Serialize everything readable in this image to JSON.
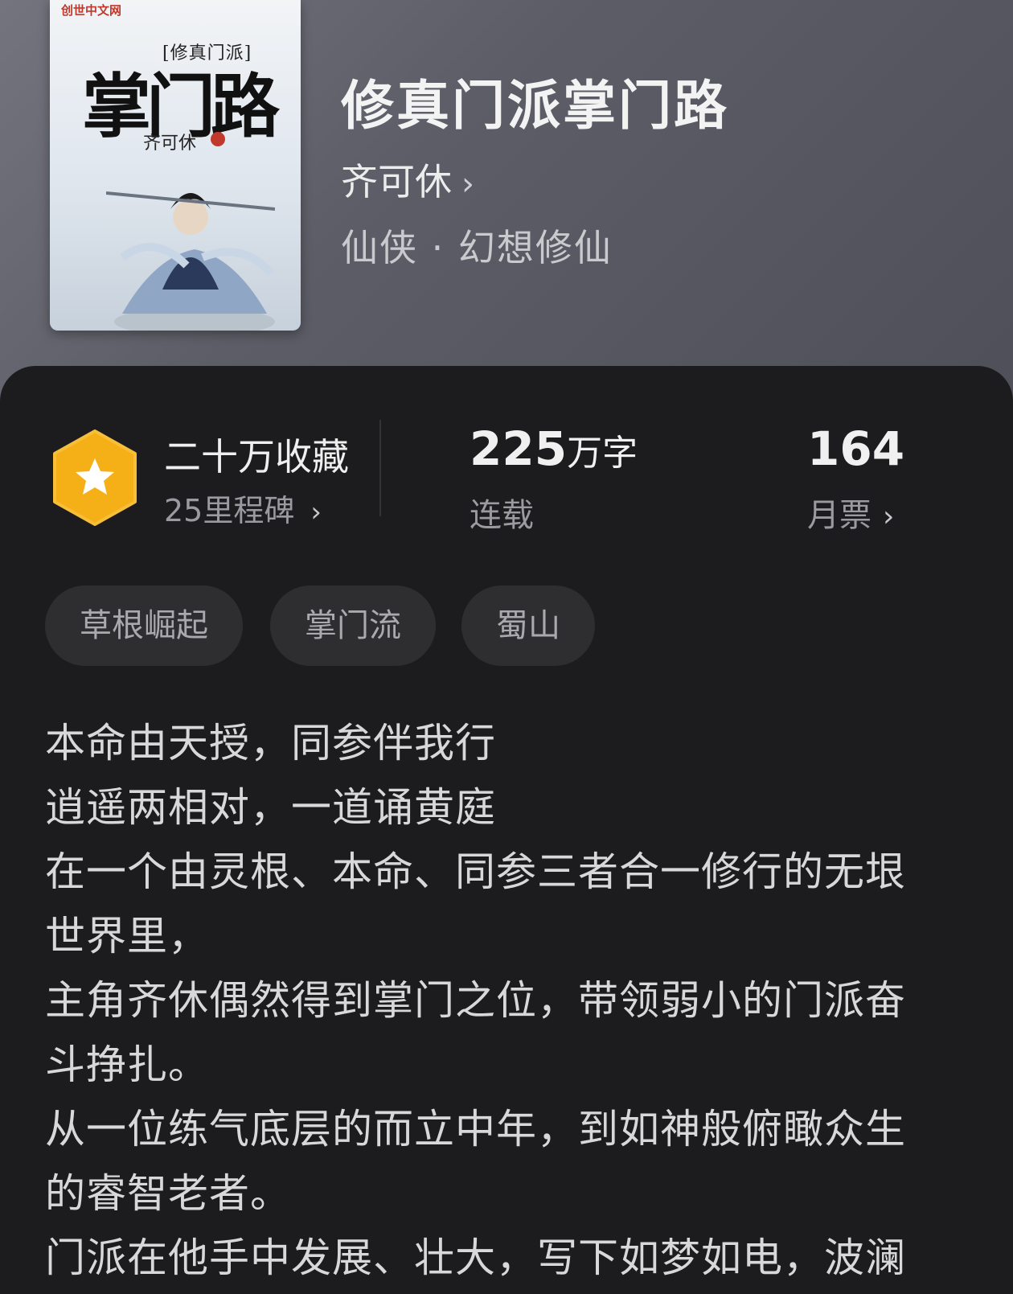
{
  "book": {
    "title": "修真门派掌门路",
    "author": "齐可休",
    "genre": "仙侠 · 幻想修仙",
    "cover": {
      "publisher_logo_text": "创世中文网",
      "series_text": "[修真门派]",
      "title_text": "掌门路",
      "author_text": "齐可休"
    }
  },
  "stats": {
    "favorites": "二十万收藏",
    "milestones": "25里程碑",
    "word_count": "225",
    "word_unit": "万字",
    "status": "连载",
    "monthly_votes": "164",
    "monthly_votes_label": "月票"
  },
  "tags": [
    "草根崛起",
    "掌门流",
    "蜀山"
  ],
  "synopsis": [
    "本命由天授，同参伴我行",
    "逍遥两相对，一道诵黄庭",
    "在一个由灵根、本命、同参三者合一修行的无垠",
    "世界里，",
    "主角齐休偶然得到掌门之位，带领弱小的门派奋",
    "斗挣扎。",
    "从一位练气底层的而立中年，到如神般俯瞰众生",
    "的睿智老者。",
    "门派在他手中发展、壮大，写下如梦如电，波澜"
  ],
  "icons": {
    "chevron": "chevron-right-icon",
    "badge": "star-hexagon-badge-icon"
  },
  "colors": {
    "badge": "#f5b018",
    "background": "#1c1c1e",
    "hero": "#62626c"
  }
}
